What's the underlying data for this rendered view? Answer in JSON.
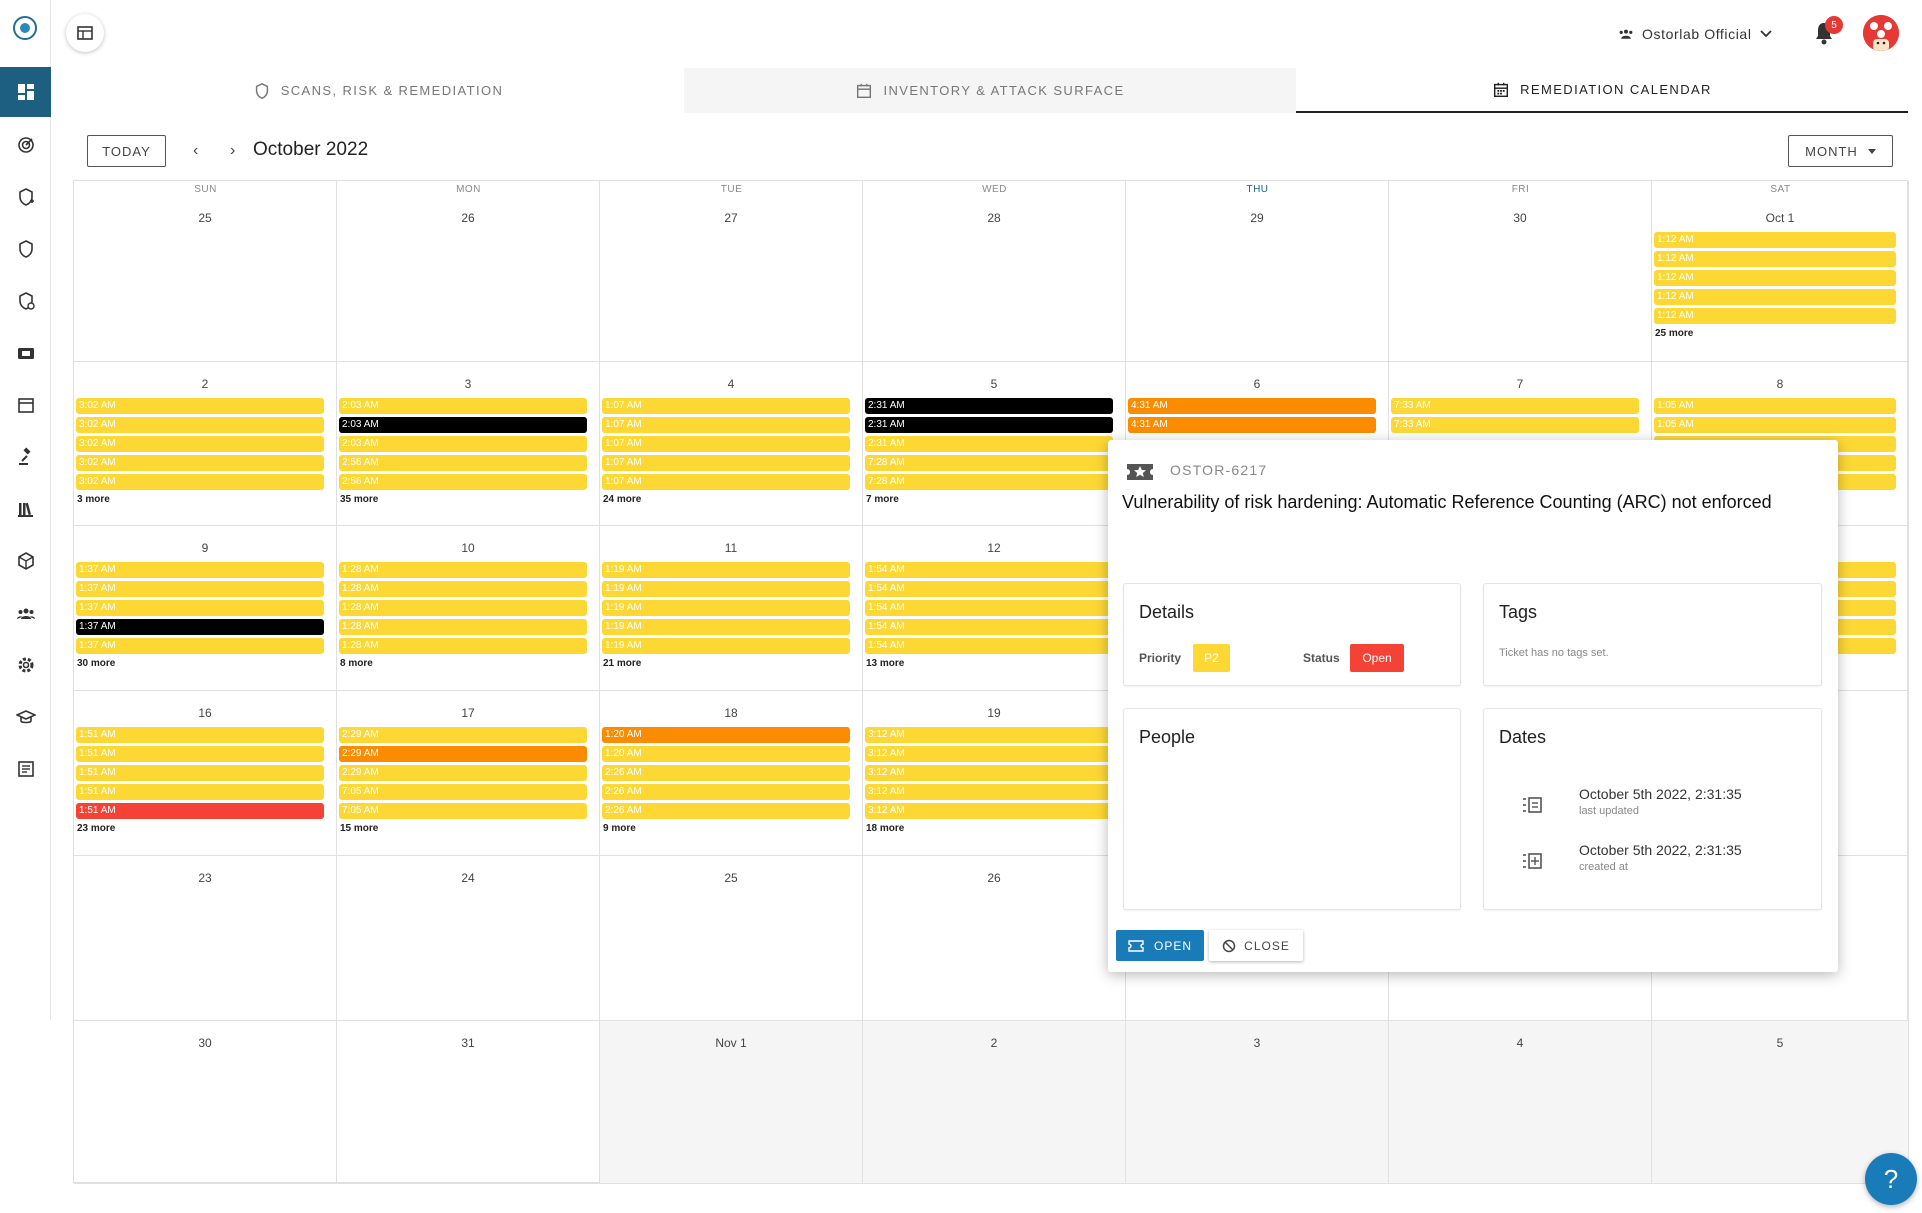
{
  "header": {
    "org_name": "Ostorlab Official",
    "notification_count": "5"
  },
  "tabs": [
    {
      "label": "SCANS, RISK & REMEDIATION",
      "icon": "shield-icon"
    },
    {
      "label": "INVENTORY & ATTACK SURFACE",
      "icon": "calendar-icon"
    },
    {
      "label": "REMEDIATION CALENDAR",
      "icon": "calendar-grid-icon",
      "active": true
    }
  ],
  "toolbar": {
    "today_label": "TODAY",
    "prev": "‹",
    "next": "›",
    "month_title": "October 2022",
    "view_label": "MONTH"
  },
  "calendar": {
    "weekdays": [
      "SUN",
      "MON",
      "TUE",
      "WED",
      "THU",
      "FRI",
      "SAT"
    ],
    "today_weekday": "THU",
    "weeks": [
      [
        {
          "day": "25",
          "off": false,
          "events": [],
          "more": ""
        },
        {
          "day": "26",
          "off": false,
          "events": [],
          "more": ""
        },
        {
          "day": "27",
          "off": false,
          "events": [],
          "more": ""
        },
        {
          "day": "28",
          "off": false,
          "events": [],
          "more": ""
        },
        {
          "day": "29",
          "off": false,
          "events": [],
          "more": ""
        },
        {
          "day": "30",
          "off": false,
          "events": [],
          "more": ""
        },
        {
          "day": "Oct 1",
          "off": false,
          "events": [
            [
              "1:12 AM",
              "y"
            ],
            [
              "1:12 AM",
              "y"
            ],
            [
              "1:12 AM",
              "y"
            ],
            [
              "1:12 AM",
              "y"
            ],
            [
              "1:12 AM",
              "y"
            ]
          ],
          "more": "25 more"
        }
      ],
      [
        {
          "day": "2",
          "off": false,
          "events": [
            [
              "3:02 AM",
              "y"
            ],
            [
              "3:02 AM",
              "y"
            ],
            [
              "3:02 AM",
              "y"
            ],
            [
              "3:02 AM",
              "y"
            ],
            [
              "3:02 AM",
              "y"
            ]
          ],
          "more": "3 more"
        },
        {
          "day": "3",
          "off": false,
          "events": [
            [
              "2:03 AM",
              "y"
            ],
            [
              "2:03 AM",
              "k"
            ],
            [
              "2:03 AM",
              "y"
            ],
            [
              "2:56 AM",
              "y"
            ],
            [
              "2:56 AM",
              "y"
            ]
          ],
          "more": "35 more"
        },
        {
          "day": "4",
          "off": false,
          "events": [
            [
              "1:07 AM",
              "y"
            ],
            [
              "1:07 AM",
              "y"
            ],
            [
              "1:07 AM",
              "y"
            ],
            [
              "1:07 AM",
              "y"
            ],
            [
              "1:07 AM",
              "y"
            ]
          ],
          "more": "24 more"
        },
        {
          "day": "5",
          "off": false,
          "events": [
            [
              "2:31 AM",
              "k"
            ],
            [
              "2:31 AM",
              "k"
            ],
            [
              "2:31 AM",
              "y"
            ],
            [
              "7:28 AM",
              "y"
            ],
            [
              "7:28 AM",
              "y"
            ]
          ],
          "more": "7 more"
        },
        {
          "day": "6",
          "off": false,
          "events": [
            [
              "4:31 AM",
              "o"
            ],
            [
              "4:31 AM",
              "o"
            ]
          ],
          "more": ""
        },
        {
          "day": "7",
          "off": false,
          "events": [
            [
              "7:33 AM",
              "y"
            ],
            [
              "7:33 AM",
              "y"
            ]
          ],
          "more": ""
        },
        {
          "day": "8",
          "off": false,
          "events": [
            [
              "1:05 AM",
              "y"
            ],
            [
              "1:05 AM",
              "y"
            ],
            [
              "",
              "y"
            ],
            [
              "",
              "y"
            ],
            [
              "",
              "y"
            ]
          ],
          "more": ""
        }
      ],
      [
        {
          "day": "9",
          "off": false,
          "events": [
            [
              "1:37 AM",
              "y"
            ],
            [
              "1:37 AM",
              "y"
            ],
            [
              "1:37 AM",
              "y"
            ],
            [
              "1:37 AM",
              "k"
            ],
            [
              "1:37 AM",
              "y"
            ]
          ],
          "more": "30 more"
        },
        {
          "day": "10",
          "off": false,
          "events": [
            [
              "1:28 AM",
              "y"
            ],
            [
              "1:28 AM",
              "y"
            ],
            [
              "1:28 AM",
              "y"
            ],
            [
              "1:28 AM",
              "y"
            ],
            [
              "1:28 AM",
              "y"
            ]
          ],
          "more": "8 more"
        },
        {
          "day": "11",
          "off": false,
          "events": [
            [
              "1:19 AM",
              "y"
            ],
            [
              "1:19 AM",
              "y"
            ],
            [
              "1:19 AM",
              "y"
            ],
            [
              "1:19 AM",
              "y"
            ],
            [
              "1:19 AM",
              "y"
            ]
          ],
          "more": "21 more"
        },
        {
          "day": "12",
          "off": false,
          "events": [
            [
              "1:54 AM",
              "y"
            ],
            [
              "1:54 AM",
              "y"
            ],
            [
              "1:54 AM",
              "y"
            ],
            [
              "1:54 AM",
              "y"
            ],
            [
              "1:54 AM",
              "y"
            ]
          ],
          "more": "13 more"
        },
        {
          "day": "",
          "off": false,
          "events": [],
          "more": ""
        },
        {
          "day": "",
          "off": false,
          "events": [],
          "more": ""
        },
        {
          "day": "",
          "off": false,
          "events": [
            [
              "",
              "y"
            ],
            [
              "",
              "y"
            ],
            [
              "",
              "y"
            ],
            [
              "",
              "y"
            ],
            [
              "",
              "y"
            ]
          ],
          "more": ""
        }
      ],
      [
        {
          "day": "16",
          "off": false,
          "events": [
            [
              "1:51 AM",
              "y"
            ],
            [
              "1:51 AM",
              "y"
            ],
            [
              "1:51 AM",
              "y"
            ],
            [
              "1:51 AM",
              "y"
            ],
            [
              "1:51 AM",
              "r"
            ]
          ],
          "more": "23 more"
        },
        {
          "day": "17",
          "off": false,
          "events": [
            [
              "2:29 AM",
              "y"
            ],
            [
              "2:29 AM",
              "o"
            ],
            [
              "2:29 AM",
              "y"
            ],
            [
              "7:05 AM",
              "y"
            ],
            [
              "7:05 AM",
              "y"
            ]
          ],
          "more": "15 more"
        },
        {
          "day": "18",
          "off": false,
          "events": [
            [
              "1:20 AM",
              "o"
            ],
            [
              "1:20 AM",
              "y"
            ],
            [
              "2:26 AM",
              "y"
            ],
            [
              "2:26 AM",
              "y"
            ],
            [
              "2:26 AM",
              "y"
            ]
          ],
          "more": "9 more"
        },
        {
          "day": "19",
          "off": false,
          "events": [
            [
              "3:12 AM",
              "y"
            ],
            [
              "3:12 AM",
              "y"
            ],
            [
              "3:12 AM",
              "y"
            ],
            [
              "3:12 AM",
              "y"
            ],
            [
              "3:12 AM",
              "y"
            ]
          ],
          "more": "18 more"
        },
        {
          "day": "",
          "off": false,
          "events": [],
          "more": ""
        },
        {
          "day": "",
          "off": false,
          "events": [],
          "more": ""
        },
        {
          "day": "",
          "off": false,
          "events": [],
          "more": ""
        }
      ],
      [
        {
          "day": "23",
          "off": false,
          "events": [],
          "more": ""
        },
        {
          "day": "24",
          "off": false,
          "events": [],
          "more": ""
        },
        {
          "day": "25",
          "off": false,
          "events": [],
          "more": ""
        },
        {
          "day": "26",
          "off": false,
          "events": [],
          "more": ""
        },
        {
          "day": "",
          "off": false,
          "events": [],
          "more": ""
        },
        {
          "day": "",
          "off": false,
          "events": [],
          "more": ""
        },
        {
          "day": "",
          "off": false,
          "events": [],
          "more": ""
        }
      ],
      [
        {
          "day": "30",
          "off": false,
          "events": [],
          "more": ""
        },
        {
          "day": "31",
          "off": false,
          "events": [],
          "more": ""
        },
        {
          "day": "Nov 1",
          "off": true,
          "events": [],
          "more": ""
        },
        {
          "day": "2",
          "off": true,
          "events": [],
          "more": ""
        },
        {
          "day": "3",
          "off": true,
          "events": [],
          "more": ""
        },
        {
          "day": "4",
          "off": true,
          "events": [],
          "more": ""
        },
        {
          "day": "5",
          "off": true,
          "events": [],
          "more": ""
        }
      ]
    ]
  },
  "popup": {
    "ticket_id": "OSTOR-6217",
    "title": "Vulnerability of risk hardening: Automatic Reference Counting (ARC) not enforced",
    "details": {
      "title": "Details",
      "priority_label": "Priority",
      "priority_value": "P2",
      "status_label": "Status",
      "status_value": "Open"
    },
    "tags": {
      "title": "Tags",
      "empty": "Ticket has no tags set."
    },
    "people": {
      "title": "People"
    },
    "dates": {
      "title": "Dates",
      "updated_value": "October 5th 2022, 2:31:35",
      "updated_label": "last updated",
      "created_value": "October 5th 2022, 2:31:35",
      "created_label": "created at"
    },
    "open_label": "OPEN",
    "close_label": "CLOSE"
  },
  "help_label": "?",
  "colors": {
    "sidebar_active": "#1d5f80",
    "event_yellow": "#fdd835",
    "event_orange": "#fb8c00",
    "event_black": "#000000",
    "event_red": "#f44336",
    "primary": "#1a7bb9"
  }
}
